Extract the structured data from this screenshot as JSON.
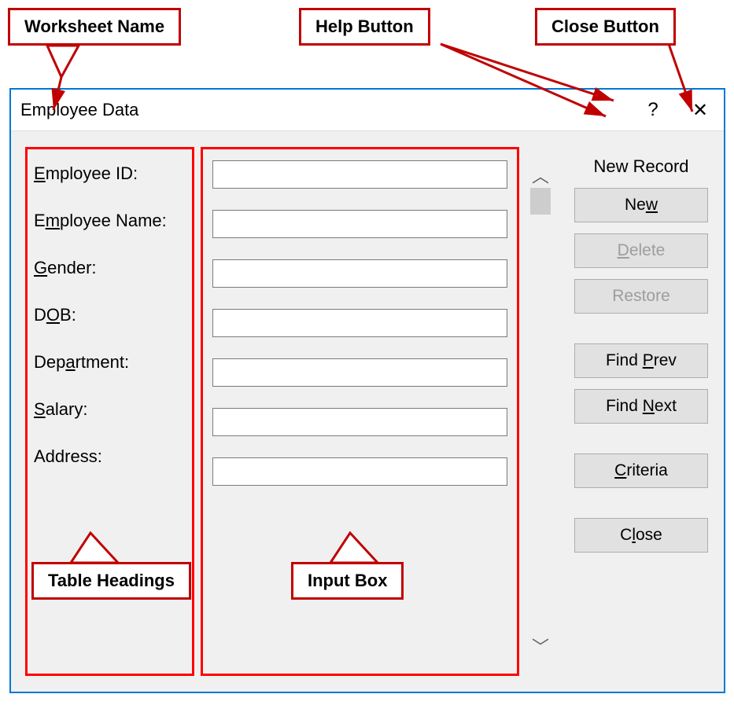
{
  "callouts": {
    "worksheet_name": "Worksheet Name",
    "help_button": "Help Button",
    "close_button": "Close Button",
    "table_headings": "Table Headings",
    "input_box": "Input Box"
  },
  "dialog": {
    "title": "Employee Data",
    "record_status": "New Record",
    "fields": {
      "employee_id": {
        "label_pre": "",
        "label_u": "E",
        "label_post": "mployee ID:",
        "value": ""
      },
      "employee_name": {
        "label_pre": "E",
        "label_u": "m",
        "label_post": "ployee Name:",
        "value": ""
      },
      "gender": {
        "label_pre": "",
        "label_u": "G",
        "label_post": "ender:",
        "value": ""
      },
      "dob": {
        "label_pre": "D",
        "label_u": "O",
        "label_post": "B:",
        "value": ""
      },
      "department": {
        "label_pre": "Dep",
        "label_u": "a",
        "label_post": "rtment:",
        "value": ""
      },
      "salary": {
        "label_pre": "",
        "label_u": "S",
        "label_post": "alary:",
        "value": ""
      },
      "address": {
        "label_pre": "Address:",
        "label_u": "",
        "label_post": "",
        "value": ""
      }
    },
    "buttons": {
      "new": {
        "pre": "Ne",
        "u": "w",
        "post": "",
        "enabled": true
      },
      "delete": {
        "pre": "",
        "u": "D",
        "post": "elete",
        "enabled": false
      },
      "restore": {
        "pre": "Restore",
        "u": "",
        "post": "",
        "enabled": false
      },
      "find_prev": {
        "pre": "Find ",
        "u": "P",
        "post": "rev",
        "enabled": true
      },
      "find_next": {
        "pre": "Find ",
        "u": "N",
        "post": "ext",
        "enabled": true
      },
      "criteria": {
        "pre": "",
        "u": "C",
        "post": "riteria",
        "enabled": true
      },
      "close": {
        "pre": "C",
        "u": "l",
        "post": "ose",
        "enabled": true
      }
    }
  }
}
